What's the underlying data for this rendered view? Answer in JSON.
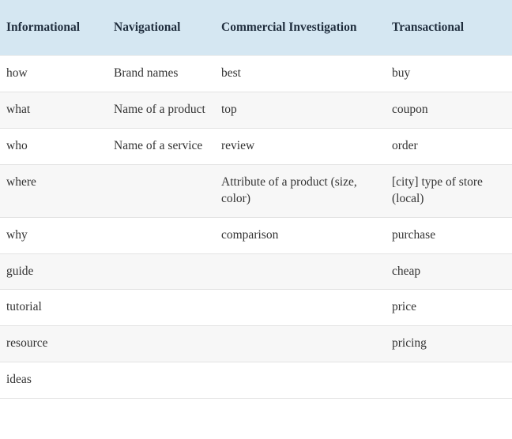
{
  "table": {
    "name": "search-intent-keyword-modifiers",
    "header": {
      "background_color": "#d5e7f2",
      "text_color": "#1f2d3d",
      "columns": [
        "Informational",
        "Navigational",
        "Commercial Investigation",
        "Transactional"
      ]
    },
    "row_stripe_color": "#f7f7f7",
    "row_base_color": "#ffffff",
    "border_color": "#e3e3e3",
    "rows": [
      [
        "how",
        "Brand names",
        "best",
        "buy"
      ],
      [
        "what",
        "Name of a product",
        "top",
        "coupon"
      ],
      [
        "who",
        "Name of a service",
        "review",
        "order"
      ],
      [
        "where",
        "",
        "Attribute of a product (size, color)",
        "[city] type of store (local)"
      ],
      [
        "why",
        "",
        "comparison",
        "purchase"
      ],
      [
        "guide",
        "",
        "",
        "cheap"
      ],
      [
        "tutorial",
        "",
        "",
        "price"
      ],
      [
        "resource",
        "",
        "",
        "pricing"
      ],
      [
        "ideas",
        "",
        "",
        ""
      ]
    ]
  }
}
